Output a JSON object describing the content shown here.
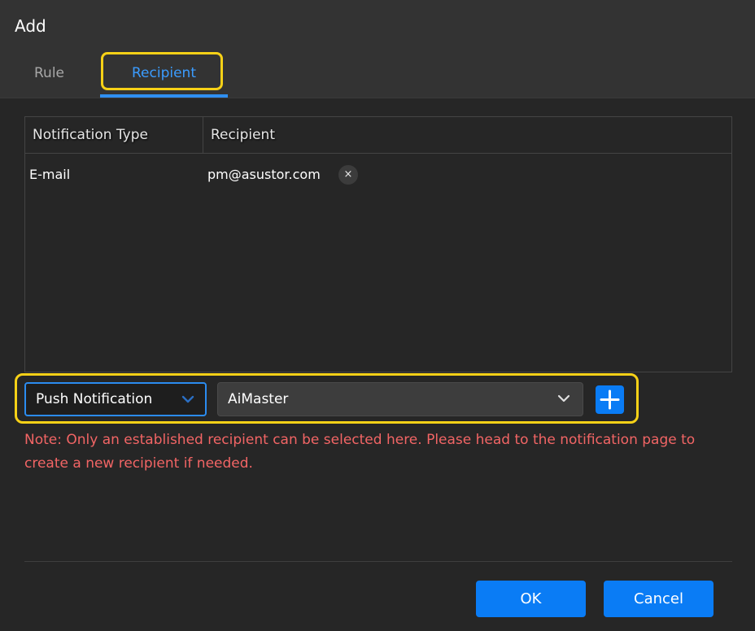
{
  "dialog": {
    "title": "Add"
  },
  "tabs": [
    {
      "label": "Rule",
      "active": false
    },
    {
      "label": "Recipient",
      "active": true
    }
  ],
  "table": {
    "columns": [
      "Notification Type",
      "Recipient"
    ],
    "rows": [
      {
        "type": "E-mail",
        "recipient": "pm@asustor.com",
        "remove_icon": "×"
      }
    ]
  },
  "controls": {
    "type_select": {
      "value": "Push Notification"
    },
    "recipient_select": {
      "value": "AiMaster"
    },
    "add_icon": "plus-icon"
  },
  "note": "Note: Only an established recipient can be selected here. Please head to the notification page to create a new recipient if needed.",
  "footer": {
    "ok_label": "OK",
    "cancel_label": "Cancel"
  },
  "colors": {
    "accent": "#0a7cf5",
    "highlight": "#f7d117",
    "note_text": "#f26565",
    "active_tab": "#3b9cff"
  }
}
